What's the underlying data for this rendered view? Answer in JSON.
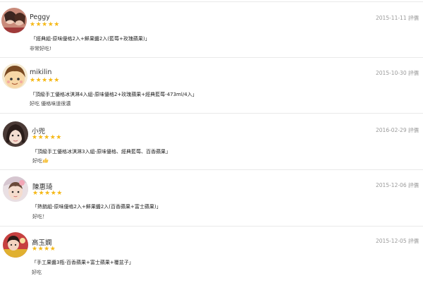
{
  "reviews": [
    {
      "name": "Peggy",
      "stars": "★★★★★",
      "date": "2015-11-11 評價",
      "product": "「經典組-原味優格2入+鮮果醬2入(藍莓+玫瑰蘋果)」",
      "comment": "非常好吃!"
    },
    {
      "name": "mikilin",
      "stars": "★★★★★",
      "date": "2015-10-30 評價",
      "product": "「頂級手工優格冰淇淋4入組-原味優格2+玫瑰蘋果+經典藍莓-473ml/4入」",
      "comment": "好吃 優格味道很濃"
    },
    {
      "name": "小兜",
      "stars": "★★★★★",
      "date": "2016-02-29 評價",
      "product": "「頂級手工優格冰淇淋3入組-原味優格、經典藍莓、百香蘋果」",
      "comment": "好吃"
    },
    {
      "name": "陳惠琦",
      "stars": "★★★★★",
      "date": "2015-12-06 評價",
      "product": "「熱銷組-原味優格2入+鮮果醬2入(百香蘋果+富士蘋果)」",
      "comment": "好吃！"
    },
    {
      "name": "高玉嫺",
      "stars": "★★★★",
      "date": "2015-12-05 評價",
      "product": "「手工果醬3瓶-百香蘋果+富士蘋果+覆盆子」",
      "comment": "好吃"
    }
  ]
}
